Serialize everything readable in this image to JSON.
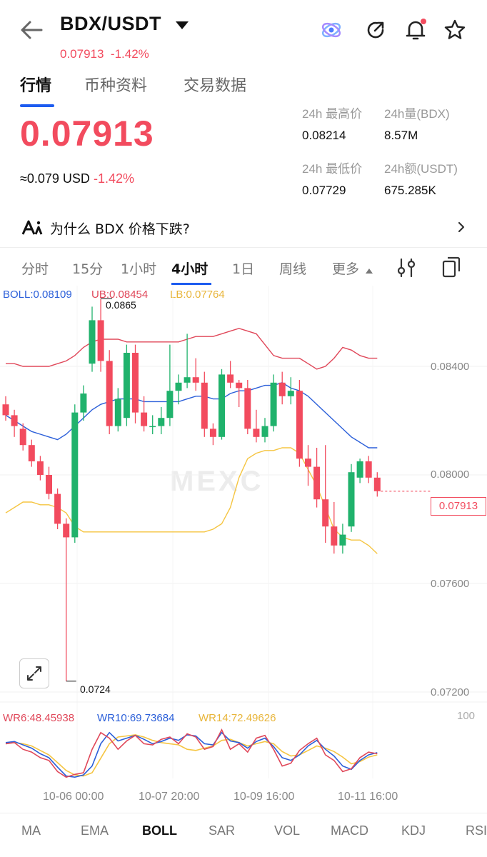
{
  "header": {
    "pair": "BDX/USDT",
    "sub_price": "0.07913",
    "sub_change": "-1.42%"
  },
  "tabs": [
    {
      "label": "行情",
      "active": true
    },
    {
      "label": "币种资料",
      "active": false
    },
    {
      "label": "交易数据",
      "active": false
    }
  ],
  "ticker": {
    "price": "0.07913",
    "usd_approx": "≈0.079 USD",
    "change": "-1.42%",
    "stats": {
      "high_label": "24h 最高价",
      "high": "0.08214",
      "vol_label": "24h量(BDX)",
      "vol": "8.57M",
      "low_label": "24h 最低价",
      "low": "0.07729",
      "amount_label": "24h额(USDT)",
      "amount": "675.285K"
    }
  },
  "why": {
    "text": "为什么 BDX 价格下跌?"
  },
  "intervals": [
    "分时",
    "15分",
    "1小时",
    "4小时",
    "1日",
    "周线",
    "更多"
  ],
  "active_interval": "4小时",
  "watermark": "MEXC",
  "colors": {
    "up": "#20b26c",
    "down": "#f24b5e",
    "mid": "#2b5fd9",
    "ub": "#e0485a",
    "lb": "#f5c542",
    "accent": "#1d5cf0"
  },
  "chart_data": {
    "type": "candlestick",
    "legend": {
      "boll": "BOLL:0.08109",
      "ub": "UB:0.08454",
      "lb": "LB:0.07764"
    },
    "y_ticks": [
      "0.08400",
      "0.08000",
      "0.07600",
      "0.07200"
    ],
    "ylim": [
      0.0712,
      0.0868
    ],
    "last_price_tag": "0.07913",
    "high_label": "0.0865",
    "low_label": "0.0724",
    "x_ticks": [
      "10-06 00:00",
      "10-07 20:00",
      "10-09 16:00",
      "10-11 16:00"
    ],
    "candles": [
      [
        0.0826,
        0.0829,
        0.082,
        0.0822
      ],
      [
        0.0822,
        0.0824,
        0.0814,
        0.0818
      ],
      [
        0.0817,
        0.0819,
        0.0809,
        0.0811
      ],
      [
        0.0811,
        0.0813,
        0.0803,
        0.0805
      ],
      [
        0.0805,
        0.0807,
        0.0798,
        0.08
      ],
      [
        0.08,
        0.0803,
        0.0791,
        0.0793
      ],
      [
        0.0793,
        0.0795,
        0.078,
        0.0782
      ],
      [
        0.0782,
        0.0784,
        0.0724,
        0.0777
      ],
      [
        0.0777,
        0.0826,
        0.0775,
        0.0823
      ],
      [
        0.0823,
        0.0833,
        0.082,
        0.083
      ],
      [
        0.0841,
        0.0862,
        0.0838,
        0.0857
      ],
      [
        0.0857,
        0.0865,
        0.0838,
        0.0842
      ],
      [
        0.0842,
        0.0846,
        0.0815,
        0.0818
      ],
      [
        0.0818,
        0.0832,
        0.0816,
        0.0828
      ],
      [
        0.0821,
        0.0848,
        0.0818,
        0.0845
      ],
      [
        0.0845,
        0.0848,
        0.0819,
        0.0823
      ],
      [
        0.0823,
        0.0829,
        0.0816,
        0.0818
      ],
      [
        0.0818,
        0.0822,
        0.0815,
        0.0818
      ],
      [
        0.0818,
        0.0825,
        0.0815,
        0.0821
      ],
      [
        0.0821,
        0.0848,
        0.0818,
        0.0831
      ],
      [
        0.0831,
        0.0837,
        0.0826,
        0.0834
      ],
      [
        0.0834,
        0.0852,
        0.0832,
        0.0836
      ],
      [
        0.0836,
        0.0843,
        0.0831,
        0.0834
      ],
      [
        0.0834,
        0.0838,
        0.0814,
        0.0817
      ],
      [
        0.0817,
        0.0819,
        0.0811,
        0.0814
      ],
      [
        0.0814,
        0.0839,
        0.0813,
        0.0837
      ],
      [
        0.0837,
        0.0842,
        0.0832,
        0.0834
      ],
      [
        0.0834,
        0.0835,
        0.0825,
        0.0832
      ],
      [
        0.0832,
        0.0835,
        0.0815,
        0.0817
      ],
      [
        0.0817,
        0.0824,
        0.0812,
        0.0814
      ],
      [
        0.0814,
        0.0821,
        0.0812,
        0.0818
      ],
      [
        0.0818,
        0.0837,
        0.0816,
        0.0834
      ],
      [
        0.0834,
        0.0838,
        0.0826,
        0.0829
      ],
      [
        0.0829,
        0.0836,
        0.0826,
        0.0831
      ],
      [
        0.0831,
        0.0835,
        0.0803,
        0.0806
      ],
      [
        0.0806,
        0.0811,
        0.0796,
        0.0803
      ],
      [
        0.0803,
        0.081,
        0.0788,
        0.0791
      ],
      [
        0.0791,
        0.0811,
        0.0775,
        0.0781
      ],
      [
        0.0781,
        0.079,
        0.0771,
        0.0774
      ],
      [
        0.0774,
        0.0782,
        0.0771,
        0.0778
      ],
      [
        0.0781,
        0.0804,
        0.0779,
        0.0801
      ],
      [
        0.0799,
        0.0806,
        0.0797,
        0.0805
      ],
      [
        0.0805,
        0.0807,
        0.0797,
        0.0799
      ],
      [
        0.0799,
        0.0801,
        0.0792,
        0.0794
      ]
    ],
    "boll_mid": [
      0.0822,
      0.082,
      0.0818,
      0.0816,
      0.0815,
      0.0814,
      0.0813,
      0.0815,
      0.0818,
      0.0821,
      0.0824,
      0.0826,
      0.0827,
      0.0828,
      0.0828,
      0.0828,
      0.0827,
      0.0827,
      0.0827,
      0.0827,
      0.0827,
      0.0828,
      0.0829,
      0.0829,
      0.0828,
      0.0828,
      0.083,
      0.0831,
      0.0831,
      0.0832,
      0.0833,
      0.0833,
      0.0834,
      0.0832,
      0.0831,
      0.0829,
      0.0826,
      0.0823,
      0.082,
      0.0817,
      0.0814,
      0.0812,
      0.081,
      0.081
    ],
    "boll_ub": [
      0.0841,
      0.0841,
      0.084,
      0.084,
      0.084,
      0.084,
      0.0841,
      0.0842,
      0.0844,
      0.0847,
      0.0849,
      0.085,
      0.085,
      0.085,
      0.0849,
      0.0849,
      0.0849,
      0.0849,
      0.0849,
      0.0849,
      0.0849,
      0.085,
      0.0851,
      0.0851,
      0.0851,
      0.0852,
      0.0853,
      0.0854,
      0.0853,
      0.0852,
      0.0848,
      0.0844,
      0.0843,
      0.0843,
      0.0843,
      0.0841,
      0.0839,
      0.084,
      0.0843,
      0.0847,
      0.0846,
      0.0844,
      0.0843,
      0.0843
    ],
    "boll_lb": [
      0.0786,
      0.0788,
      0.079,
      0.079,
      0.0789,
      0.0789,
      0.0788,
      0.0786,
      0.0781,
      0.0779,
      0.0779,
      0.0779,
      0.0779,
      0.0779,
      0.0779,
      0.0779,
      0.0779,
      0.0779,
      0.0779,
      0.0779,
      0.0779,
      0.0779,
      0.0779,
      0.0779,
      0.078,
      0.0782,
      0.0788,
      0.0799,
      0.0806,
      0.0808,
      0.0809,
      0.0809,
      0.081,
      0.081,
      0.0808,
      0.0802,
      0.0796,
      0.0788,
      0.078,
      0.0777,
      0.0776,
      0.0776,
      0.0774,
      0.0771
    ],
    "wr_legend": {
      "wr6": "WR6:48.45938",
      "wr10": "WR10:69.73684",
      "wr14": "WR14:72.49626"
    },
    "wr_scale": "100",
    "wr6": [
      70,
      72,
      60,
      55,
      45,
      40,
      20,
      10,
      15,
      18,
      60,
      90,
      80,
      60,
      75,
      85,
      70,
      68,
      78,
      82,
      70,
      88,
      82,
      60,
      65,
      95,
      60,
      70,
      55,
      80,
      85,
      60,
      30,
      35,
      58,
      70,
      80,
      50,
      40,
      20,
      25,
      45,
      55,
      52
    ],
    "wr10": [
      72,
      74,
      68,
      62,
      52,
      45,
      28,
      12,
      10,
      14,
      30,
      70,
      90,
      75,
      80,
      85,
      78,
      70,
      74,
      80,
      76,
      86,
      84,
      70,
      68,
      90,
      75,
      72,
      62,
      74,
      80,
      65,
      45,
      40,
      50,
      66,
      76,
      60,
      48,
      30,
      24,
      40,
      50,
      54
    ],
    "wr14": [
      70,
      72,
      70,
      66,
      58,
      50,
      36,
      22,
      14,
      12,
      18,
      44,
      70,
      82,
      84,
      86,
      82,
      76,
      72,
      70,
      68,
      60,
      58,
      62,
      66,
      76,
      78,
      72,
      66,
      70,
      74,
      70,
      56,
      48,
      50,
      58,
      66,
      62,
      56,
      46,
      34,
      38,
      46,
      50
    ]
  },
  "indicators": {
    "labels": [
      "MA",
      "EMA",
      "BOLL",
      "SAR",
      "VOL",
      "MACD",
      "KDJ",
      "RSI"
    ],
    "active": "BOLL"
  }
}
